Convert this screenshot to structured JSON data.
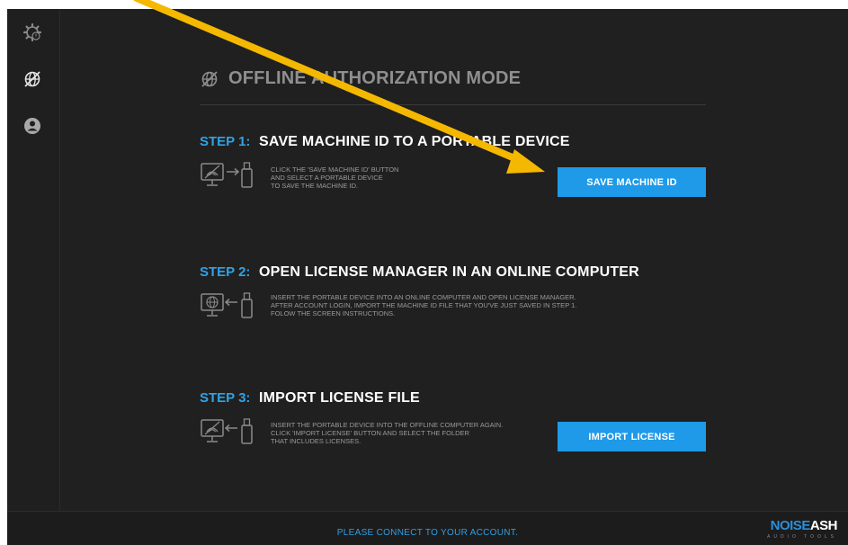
{
  "sidebar": {
    "items": [
      {
        "icon": "settings-gear-icon"
      },
      {
        "icon": "offline-globe-icon"
      },
      {
        "icon": "user-account-icon"
      }
    ]
  },
  "main": {
    "mode_icon": "offline-globe-icon",
    "title": "OFFLINE AUTHORIZATION MODE",
    "steps": [
      {
        "number": "STEP 1:",
        "title": "SAVE MACHINE ID TO A PORTABLE DEVICE",
        "description_lines": [
          "CLICK THE 'SAVE MACHINE ID' BUTTON",
          "AND SELECT A PORTABLE DEVICE",
          "TO SAVE THE MACHINE ID."
        ],
        "icon": "computer-to-usb-icon",
        "button": "SAVE MACHINE ID"
      },
      {
        "number": "STEP 2:",
        "title": "OPEN LICENSE MANAGER IN AN ONLINE COMPUTER",
        "description_lines": [
          "INSERT THE PORTABLE DEVICE INTO AN ONLINE COMPUTER AND OPEN LICENSE MANAGER.",
          "AFTER ACCOUNT LOGIN, IMPORT THE MACHINE ID FILE THAT YOU'VE JUST SAVED IN STEP 1.",
          "FOLOW THE SCREEN INSTRUCTIONS."
        ],
        "icon": "usb-to-online-computer-icon"
      },
      {
        "number": "STEP 3:",
        "title": "IMPORT LICENSE FILE",
        "description_lines": [
          "INSERT THE PORTABLE DEVICE INTO THE OFFLINE COMPUTER AGAIN.",
          "CLICK 'IMPORT LICENSE' BUTTON AND SELECT THE FOLDER",
          "THAT INCLUDES LICENSES."
        ],
        "icon": "usb-to-offline-computer-icon",
        "button": "IMPORT LICENSE"
      }
    ]
  },
  "footer": {
    "message": "PLEASE CONNECT TO YOUR ACCOUNT.",
    "logo_noise": "NOISE",
    "logo_ash": "ASH",
    "logo_sub": "AUDIO TOOLS"
  },
  "annotation": {
    "color": "#f5b800"
  },
  "colors": {
    "accent": "#1e9ae8",
    "step_number": "#2fa3e8",
    "background": "#202020"
  }
}
